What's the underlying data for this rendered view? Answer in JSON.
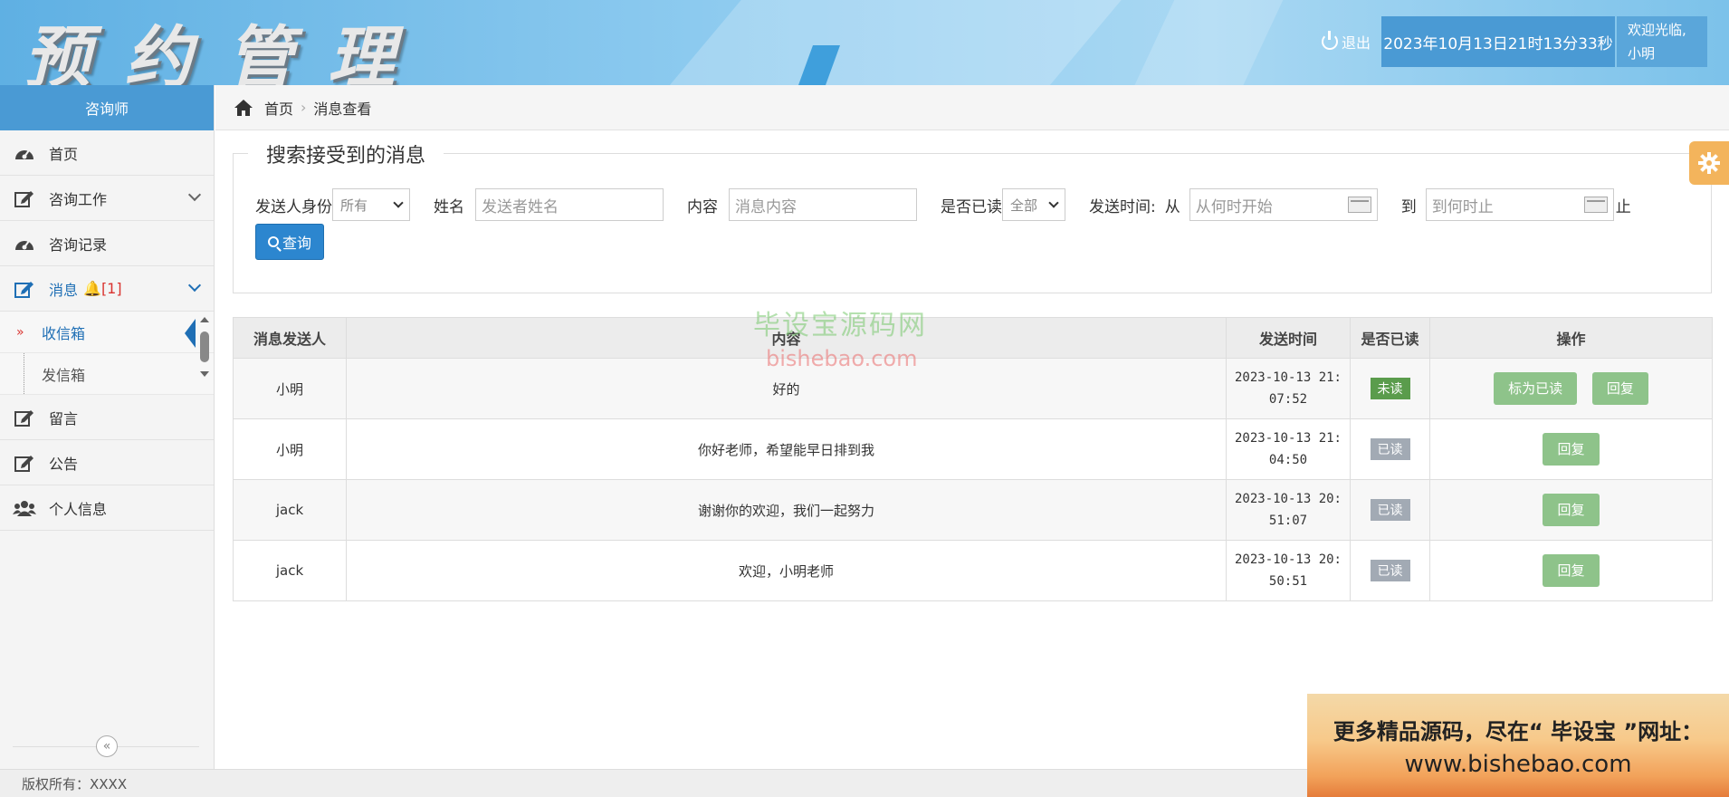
{
  "header": {
    "logo_text": "预约管理",
    "logout_label": "退出",
    "datetime": "2023年10月13日21时13分33秒",
    "welcome_line1": "欢迎光临,",
    "welcome_line2": "小明"
  },
  "sidebar": {
    "role_title": "咨询师",
    "items": [
      {
        "label": "首页",
        "icon": "dashboard-icon"
      },
      {
        "label": "咨询工作",
        "icon": "edit-icon"
      },
      {
        "label": "咨询记录",
        "icon": "dashboard-icon"
      },
      {
        "label": "消息",
        "icon": "edit-icon",
        "badge": "🔔[1]"
      },
      {
        "label": "留言",
        "icon": "edit-icon"
      },
      {
        "label": "公告",
        "icon": "edit-icon"
      },
      {
        "label": "个人信息",
        "icon": "users-icon"
      }
    ],
    "submenu": [
      {
        "label": "收信箱",
        "active": true
      },
      {
        "label": "发信箱",
        "active": false
      }
    ],
    "collapse_symbol": "«"
  },
  "breadcrumb": {
    "home": "首页",
    "separator": "›",
    "current": "消息查看"
  },
  "search": {
    "legend": "搜索接受到的消息",
    "sender_role_label": "发送人身份",
    "sender_role_value": "所有",
    "name_label": "姓名",
    "name_placeholder": "发送者姓名",
    "content_label": "内容",
    "content_placeholder": "消息内容",
    "read_label": "是否已读",
    "read_value": "全部",
    "time_label": "发送时间:",
    "from_label": "从",
    "from_placeholder": "从何时开始",
    "to_label": "到",
    "to_placeholder": "到何时止",
    "end_label": "止",
    "query_label": "查询"
  },
  "table": {
    "headers": [
      "消息发送人",
      "内容",
      "发送时间",
      "是否已读",
      "操作"
    ],
    "rows": [
      {
        "sender": "小明",
        "content": "好的",
        "time_date": "2023-10-13 21:",
        "time_rest": "07:52",
        "status": "未读",
        "mark_label": "标为已读",
        "reply_label": "回复"
      },
      {
        "sender": "小明",
        "content": "你好老师，希望能早日排到我",
        "time_date": "2023-10-13 21:",
        "time_rest": "04:50",
        "status": "已读",
        "reply_label": "回复"
      },
      {
        "sender": "jack",
        "content": "谢谢你的欢迎，我们一起努力",
        "time_date": "2023-10-13 20:",
        "time_rest": "51:07",
        "status": "已读",
        "reply_label": "回复"
      },
      {
        "sender": "jack",
        "content": "欢迎，小明老师",
        "time_date": "2023-10-13 20:",
        "time_rest": "50:51",
        "status": "已读",
        "reply_label": "回复"
      }
    ]
  },
  "watermark": {
    "line1": "毕设宝源码网",
    "line2": "bishebao.com"
  },
  "footer": {
    "copyright": "版权所有：XXXX"
  },
  "promo": {
    "line1": "更多精品源码，尽在“ 毕设宝 ”网址：",
    "line2": "www.bishebao.com"
  },
  "colors": {
    "primary": "#4a9ad4",
    "query_button": "#2c86cf",
    "action_button": "#8ec38a",
    "unread_badge": "#5a9c4c",
    "read_badge": "#a2aab4"
  }
}
